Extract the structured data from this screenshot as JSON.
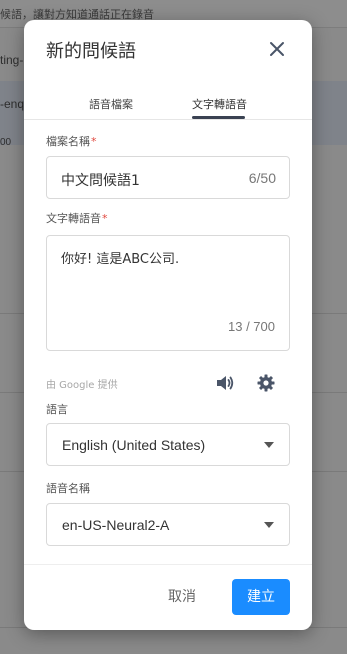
{
  "background": {
    "notice": "候語，讓對方知道通話正在錄音",
    "row1": "ting-",
    "row2": "-enq",
    "row3": "00"
  },
  "dialog": {
    "title": "新的問候語",
    "close_icon": "close-icon",
    "tabs": [
      {
        "label": "語音檔案",
        "active": false
      },
      {
        "label": "文字轉語音",
        "active": true
      }
    ],
    "file_name": {
      "label": "檔案名稱",
      "required_mark": "*",
      "value": "中文問候語1",
      "counter": "6/50"
    },
    "tts": {
      "label": "文字轉語音",
      "required_mark": "*",
      "value": "你好! 這是ABC公司.",
      "counter": "13 / 700"
    },
    "provider_text": "由 Google 提供",
    "icons": {
      "play": "speaker-icon",
      "settings": "gear-icon"
    },
    "language": {
      "label": "語言",
      "selected": "English (United States)"
    },
    "voice_name": {
      "label": "語音名稱",
      "selected": "en-US-Neural2-A"
    },
    "buttons": {
      "cancel": "取消",
      "create": "建立"
    }
  },
  "colors": {
    "primary": "#1a8cff",
    "required": "#e0483e",
    "tab_underline": "#3a4252"
  }
}
